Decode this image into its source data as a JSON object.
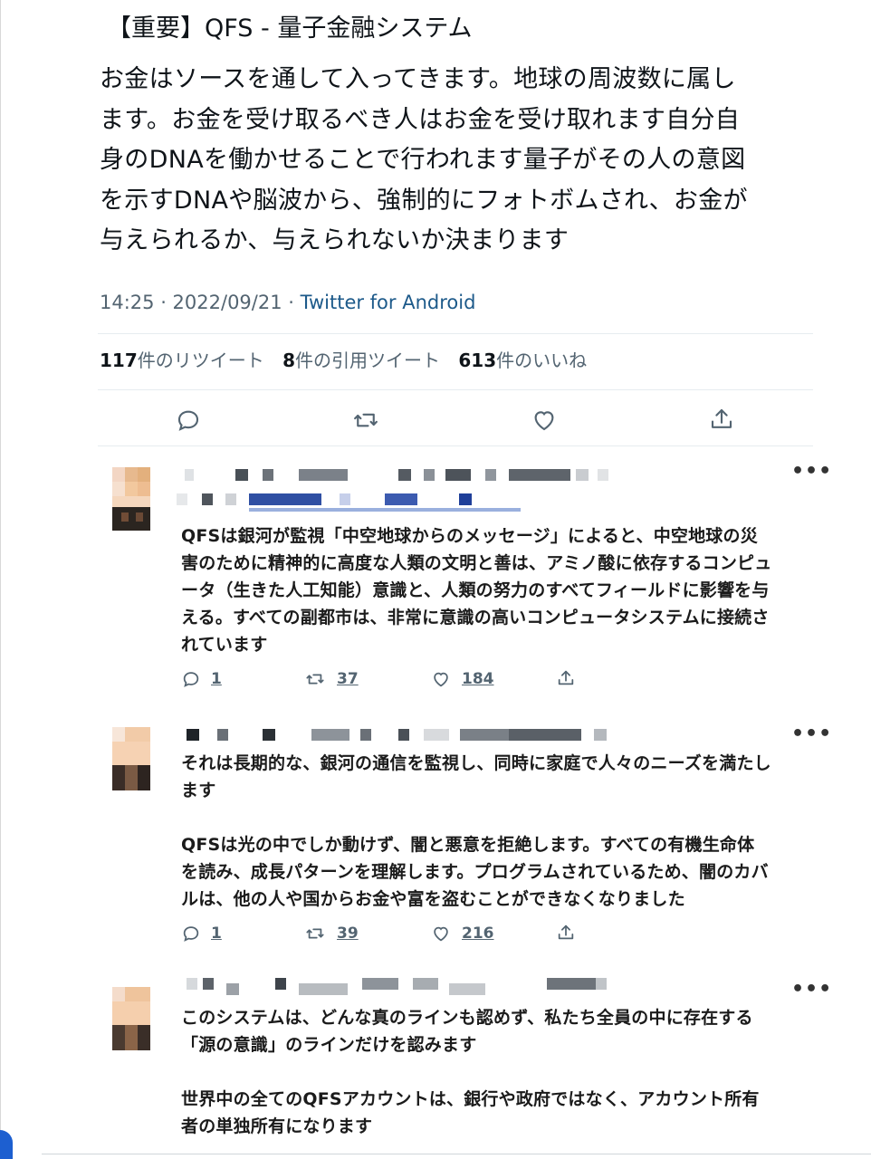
{
  "tweet": {
    "heading": "【重要】QFS - 量子金融システム",
    "body_lines": [
      "お金はソースを通して入ってきます。地球の周波数に属し",
      "ます。お金を受け取るべき人はお金を受け取れます自分自",
      "身のDNAを働かせることで行われます量子がその人の意図",
      "を示すDNAや脳波から、強制的にフォトボムされ、お金が",
      "与えられるか、与えられないか決まります"
    ],
    "time": "14:25 · 2022/09/21 · ",
    "via": "Twitter for Android",
    "stats": {
      "retweets_num": "117",
      "retweets_label": "件のリツイート",
      "quotes_num": "8",
      "quotes_label": "件の引用ツイート",
      "likes_num": "613",
      "likes_label": "件のいいね"
    },
    "icons": [
      "reply-icon",
      "retweet-icon",
      "like-icon",
      "share-icon"
    ]
  },
  "replies": [
    {
      "text_lines": [
        "QFSは銀河が監視「中空地球からのメッセージ」によると、中空地球の災",
        "害のために精神的に高度な人類の文明と善は、アミノ酸に依存するコンピュ",
        "ータ（生きた人工知能）意識と、人類の努力のすべてフィールドに影響を与",
        "える。すべての副都市は、非常に意識の高いコンピュータシステムに接続さ",
        "れています"
      ],
      "reply_count": "1",
      "retweet_count": "37",
      "like_count": "184"
    },
    {
      "text_lines": [
        "それは長期的な、銀河の通信を監視し、同時に家庭で人々のニーズを満たし",
        "ます",
        "",
        "QFSは光の中でしか動けず、闇と悪意を拒絶します。すべての有機生命体",
        "を読み、成長パターンを理解します。プログラムされているため、闇のカバ",
        "ルは、他の人や国からお金や富を盗むことができなくなりました"
      ],
      "reply_count": "1",
      "retweet_count": "39",
      "like_count": "216"
    },
    {
      "text_lines": [
        "このシステムは、どんな真のラインも認めず、私たち全員の中に存在する",
        "「源の意識」のラインだけを認みます",
        "",
        "世界中の全てのQFSアカウントは、銀行や政府ではなく、アカウント所有",
        "者の単独所有になります"
      ]
    }
  ],
  "more_label": "•••",
  "colors": {
    "text": "#0f1419",
    "secondary": "#536471",
    "link": "#1d5a8a",
    "divider": "#e6ecf0"
  }
}
